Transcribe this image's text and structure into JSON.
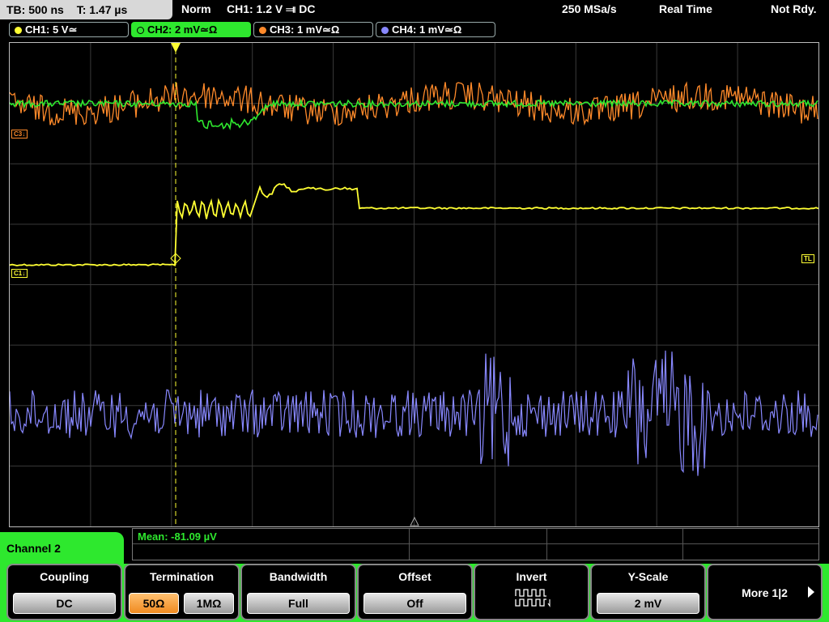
{
  "topbar": {
    "timebase": "TB: 500 ns",
    "trigger_time": "T: 1.47 µs",
    "mode": "Norm",
    "trigger_info": "CH1: 1.2 V ⫥ DC",
    "sample_rate": "250 MSa/s",
    "acq_mode": "Real Time",
    "status": "Not Rdy."
  },
  "channels": [
    {
      "label": "CH1: 5 V≃",
      "color": "#ffff33"
    },
    {
      "label": "CH2: 2 mV≃Ω",
      "color": "#2ee82e"
    },
    {
      "label": "CH3: 1 mV≃Ω",
      "color": "#ff8a2a"
    },
    {
      "label": "CH4: 1 mV≃Ω",
      "color": "#8888ff"
    }
  ],
  "markers": {
    "c3": "C3↓",
    "c1": "C1↓",
    "tl": "TL"
  },
  "measurement": {
    "label": "Mean: -81.09 µV"
  },
  "active_channel": {
    "label": "Channel 2"
  },
  "softkeys": {
    "coupling": {
      "title": "Coupling",
      "value": "DC"
    },
    "termination": {
      "title": "Termination",
      "opt1": "50Ω",
      "opt2": "1MΩ"
    },
    "bandwidth": {
      "title": "Bandwidth",
      "value": "Full"
    },
    "offset": {
      "title": "Offset",
      "value": "Off"
    },
    "invert": {
      "title": "Invert"
    },
    "yscale": {
      "title": "Y-Scale",
      "value": "2 mV"
    },
    "more": {
      "label": "More 1|2"
    }
  }
}
